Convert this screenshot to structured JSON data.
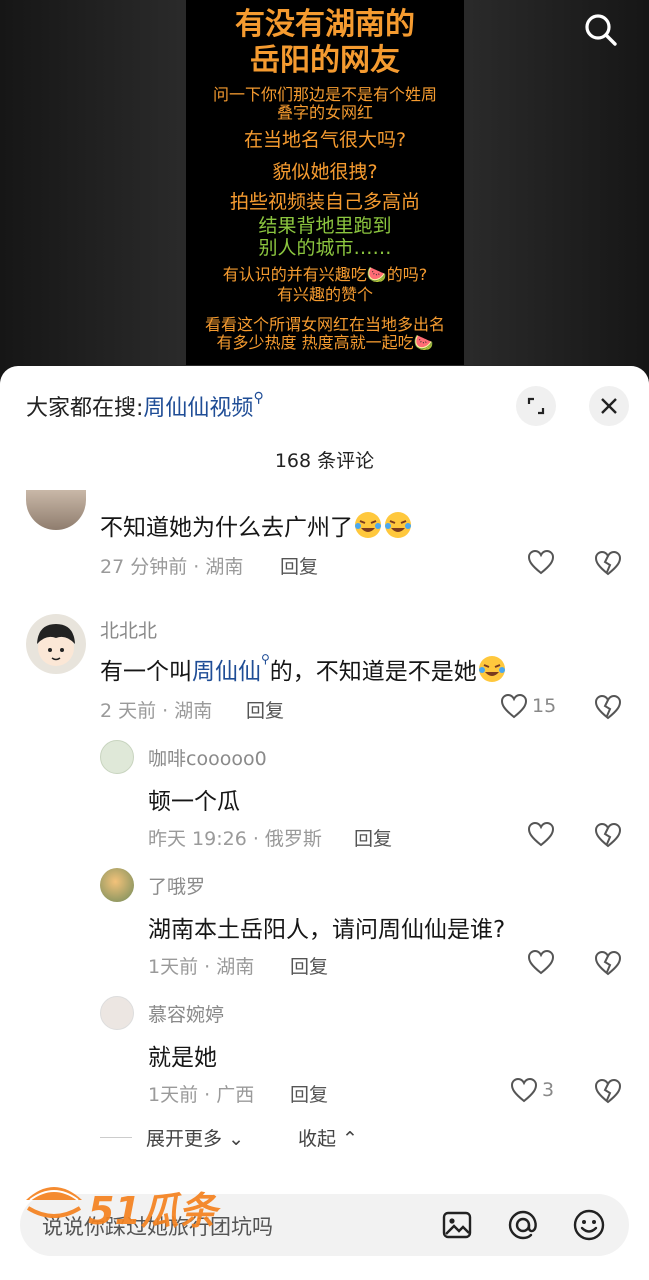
{
  "video": {
    "title_line1": "有没有湖南的",
    "title_line2": "岳阳的网友",
    "lines": [
      {
        "text": "问一下你们那边是不是有个姓周",
        "color": "orange"
      },
      {
        "text": "叠字的女网红",
        "color": "orange"
      },
      {
        "text": "在当地名气很大吗?",
        "color": "orange"
      },
      {
        "text": "貌似她很拽?",
        "color": "orange"
      },
      {
        "text": "拍些视频装自己多高尚",
        "color": "orange"
      },
      {
        "text": "结果背地里跑到",
        "color": "green"
      },
      {
        "text": "别人的城市……",
        "color": "green"
      },
      {
        "text": "有认识的并有兴趣吃🍉的吗?",
        "color": "orange"
      },
      {
        "text": "有兴趣的赞个",
        "color": "orange"
      },
      {
        "text": "看看这个所谓女网红在当地多出名",
        "color": "orange"
      },
      {
        "text": "有多少热度 热度高就一起吃🍉",
        "color": "orange"
      }
    ]
  },
  "header": {
    "hot_search_label": "大家都在搜:",
    "hot_search_keyword": "周仙仙视频",
    "comment_count": "168 条评论"
  },
  "comments": [
    {
      "user": "",
      "text": "不知道她为什么去广州了",
      "time_location": "27 分钟前 · 湖南",
      "reply": "回复",
      "likes": ""
    },
    {
      "user": "北北北",
      "text_before": "有一个叫",
      "text_link": "周仙仙",
      "text_after": "的，不知道是不是她",
      "time_location": "2 天前 · 湖南",
      "reply": "回复",
      "likes": "15"
    },
    {
      "user": "咖啡cooooo0",
      "text": "顿一个瓜",
      "time_location": "昨天 19:26 · 俄罗斯",
      "reply": "回复",
      "likes": ""
    },
    {
      "user": "了哦罗",
      "text": "湖南本土岳阳人，请问周仙仙是谁?",
      "time_location": "1天前 · 湖南",
      "reply": "回复",
      "likes": ""
    },
    {
      "user": "慕容婉婷",
      "text": "就是她",
      "time_location": "1天前 · 广西",
      "reply": "回复",
      "likes": "3"
    }
  ],
  "expand": {
    "more": "展开更多",
    "collapse": "收起"
  },
  "input": {
    "placeholder": "说说你踩过她旅行团坑吗"
  },
  "watermark": {
    "text": "51瓜条"
  },
  "colors": {
    "link": "#1f4d96",
    "video_orange": "#f59b30",
    "video_green": "#8cc63f",
    "watermark": "#f5821f"
  }
}
